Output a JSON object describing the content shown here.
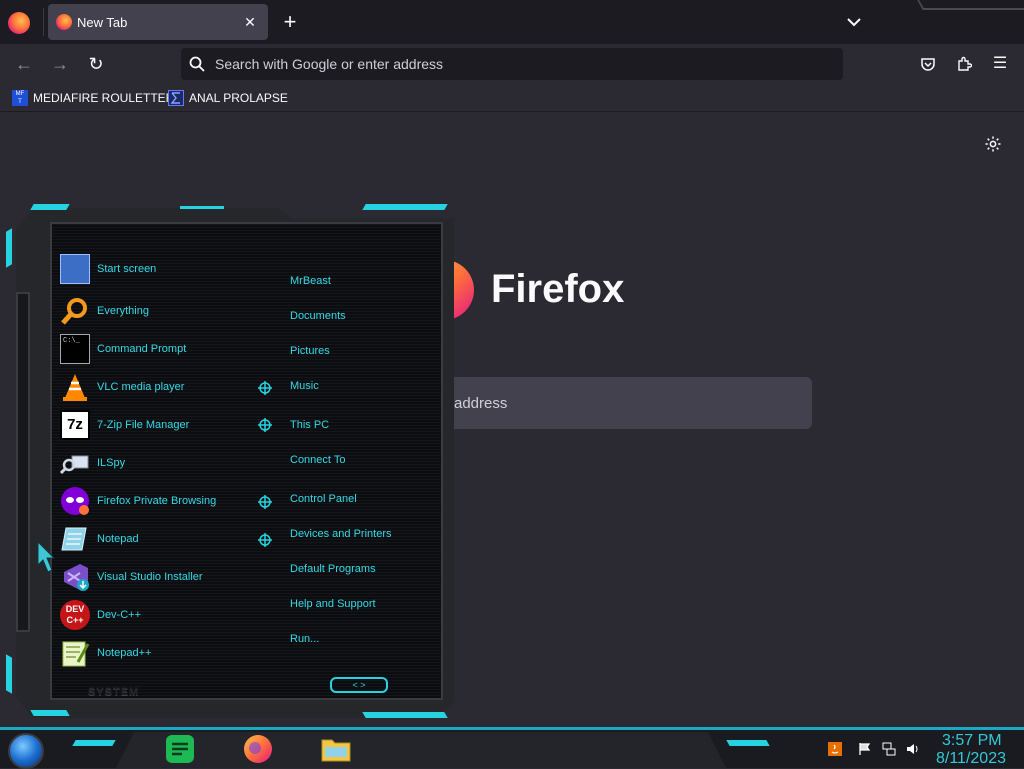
{
  "browser": {
    "tabs": [
      {
        "title": "New Tab",
        "close": "✕"
      }
    ],
    "new_tab": "+",
    "nav": {
      "back": "←",
      "forward": "→",
      "reload": "↻",
      "menu": "☰"
    },
    "urlbar_placeholder": "Search with Google or enter address",
    "bookmarks": [
      {
        "label": "MEDIAFIRE ROULETTER",
        "icon": "mft-icon"
      },
      {
        "label": "ANAL PROLAPSE",
        "icon": "sigma-icon"
      }
    ]
  },
  "newtab": {
    "brand": "Firefox",
    "search_placeholder": "address"
  },
  "start_menu": {
    "programs": [
      {
        "label": "Start screen",
        "icon": "start-screen-icon"
      },
      {
        "label": "Everything",
        "icon": "magnifier-icon"
      },
      {
        "label": "Command Prompt",
        "icon": "cmd-icon"
      },
      {
        "label": "VLC media player",
        "icon": "vlc-cone-icon"
      },
      {
        "label": "7-Zip File Manager",
        "icon": "7zip-icon"
      },
      {
        "label": "ILSpy",
        "icon": "ilspy-icon"
      },
      {
        "label": "Firefox Private Browsing",
        "icon": "private-browsing-icon"
      },
      {
        "label": "Notepad",
        "icon": "notepad-icon"
      },
      {
        "label": "Visual Studio Installer",
        "icon": "vs-installer-icon"
      },
      {
        "label": "Dev-C++",
        "icon": "devcpp-icon"
      },
      {
        "label": "Notepad++",
        "icon": "notepadpp-icon"
      }
    ],
    "places": [
      "MrBeast",
      "Documents",
      "Pictures",
      "Music",
      "This PC",
      "Connect To",
      "Control Panel",
      "Devices and Printers",
      "Default Programs",
      "Help and Support",
      "Run..."
    ],
    "system_label": "SYSTEM",
    "pager": "< >"
  },
  "taskbar": {
    "apps": [
      "notes-app-icon",
      "firefox-icon",
      "file-explorer-icon"
    ],
    "tray": [
      "java-icon",
      "flag-icon",
      "network-icon",
      "volume-icon"
    ],
    "clock_time": "3:57 PM",
    "clock_date": "8/11/2023"
  },
  "colors": {
    "accent_cyan": "#26d3e0",
    "browser_dark": "#1c1b22",
    "page_bg": "#2b2a33"
  }
}
